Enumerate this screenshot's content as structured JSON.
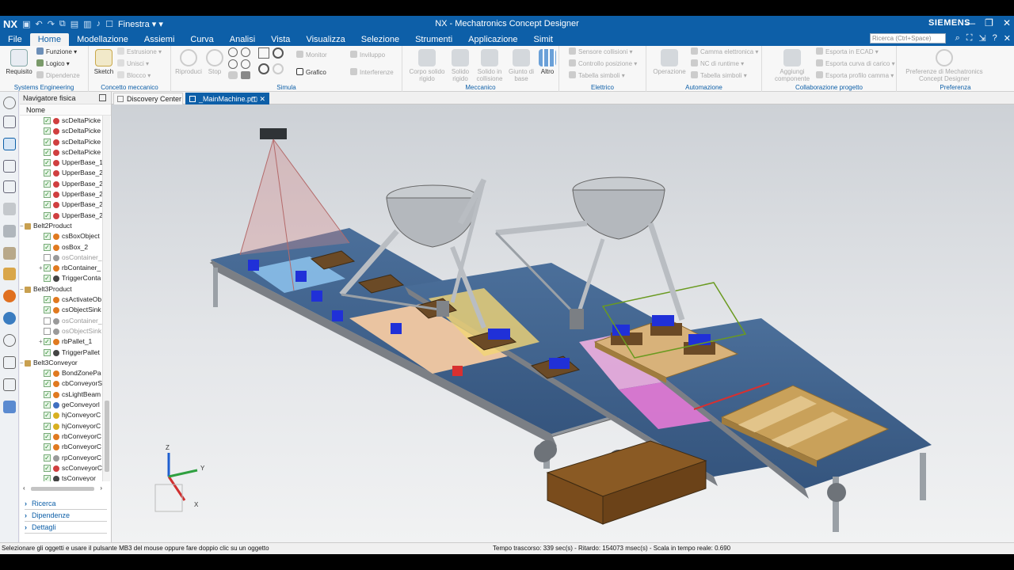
{
  "titlebar": {
    "logo": "NX",
    "window_menu": "Finestra",
    "title": "NX - Mechatronics Concept Designer",
    "brand": "SIEMENS"
  },
  "menubar": {
    "items": [
      "File",
      "Home",
      "Modellazione",
      "Assiemi",
      "Curva",
      "Analisi",
      "Vista",
      "Visualizza",
      "Selezione",
      "Strumenti",
      "Applicazione",
      "Simit"
    ],
    "search_placeholder": "Ricerca (Ctrl+Space)"
  },
  "ribbon": {
    "groups": [
      "Systems Engineering",
      "Concetto meccanico",
      "Simula",
      "Meccanico",
      "Elettrico",
      "Automazione",
      "Collaborazione progetto",
      "Preferenza"
    ],
    "requisito": "Requisito",
    "funzione": "Funzione",
    "logico": "Logico",
    "dipendenze": "Dipendenze",
    "sketch": "Sketch",
    "estrusione": "Estrusione",
    "unisci": "Unisci",
    "blocco": "Blocco",
    "riproduci": "Riproduci",
    "stop": "Stop",
    "monitor": "Monitor",
    "inviluppo": "Inviluppo",
    "grafico": "Grafico",
    "interferenze": "Interferenze",
    "corpo_rigido": "Corpo solido rigido",
    "solido_rigido": "Solido rigido",
    "solido_collisione": "Solido in collisione",
    "giunto_base": "Giunto di base",
    "altro": "Altro",
    "sensore_collisioni": "Sensore collisioni",
    "controllo_posizione": "Controllo posizione",
    "tabella_simboli": "Tabella simboli",
    "operazione": "Operazione",
    "camma_elettronica": "Camma elettronica",
    "nc_runtime": "NC di runtime",
    "tabella_simboli_2": "Tabella simboli",
    "aggiungi_componente": "Aggiungi componente",
    "esporta_ecad": "Esporta in ECAD",
    "esporta_curva": "Esporta curva di carico",
    "esporta_profilo": "Esporta profilo camma",
    "preferenze_mcd": "Preferenze di Mechatronics Concept Designer"
  },
  "navigator": {
    "title": "Navigatore fisica",
    "column": "Nome",
    "rows": [
      {
        "label": "scDeltaPicke",
        "indent": 3,
        "checked": true,
        "icon": "red"
      },
      {
        "label": "scDeltaPicke",
        "indent": 3,
        "checked": true,
        "icon": "red"
      },
      {
        "label": "scDeltaPicke",
        "indent": 3,
        "checked": true,
        "icon": "red"
      },
      {
        "label": "scDeltaPicke",
        "indent": 3,
        "checked": true,
        "icon": "red"
      },
      {
        "label": "UpperBase_1",
        "indent": 3,
        "checked": true,
        "icon": "red"
      },
      {
        "label": "UpperBase_2",
        "indent": 3,
        "checked": true,
        "icon": "red"
      },
      {
        "label": "UpperBase_2",
        "indent": 3,
        "checked": true,
        "icon": "red"
      },
      {
        "label": "UpperBase_2",
        "indent": 3,
        "checked": true,
        "icon": "red"
      },
      {
        "label": "UpperBase_2",
        "indent": 3,
        "checked": true,
        "icon": "red"
      },
      {
        "label": "UpperBase_2",
        "indent": 3,
        "checked": true,
        "icon": "red"
      },
      {
        "label": "Belt2Product",
        "indent": 1,
        "checked": null,
        "icon": "folder",
        "expander": "−"
      },
      {
        "label": "csBoxObject",
        "indent": 3,
        "checked": true,
        "icon": "orange"
      },
      {
        "label": "osBox_2",
        "indent": 3,
        "checked": true,
        "icon": "orange"
      },
      {
        "label": "osContainer_",
        "indent": 3,
        "checked": false,
        "icon": "grey",
        "dim": true
      },
      {
        "label": "rbContainer_",
        "indent": 3,
        "checked": true,
        "icon": "orange",
        "expander": "+"
      },
      {
        "label": "TriggerConta",
        "indent": 3,
        "checked": true,
        "icon": "dark"
      },
      {
        "label": "Belt3Product",
        "indent": 1,
        "checked": null,
        "icon": "folder",
        "expander": "−"
      },
      {
        "label": "csActivateOb",
        "indent": 3,
        "checked": true,
        "icon": "orange"
      },
      {
        "label": "csObjectSink",
        "indent": 3,
        "checked": true,
        "icon": "orange"
      },
      {
        "label": "osContainer_",
        "indent": 3,
        "checked": false,
        "icon": "grey",
        "dim": true
      },
      {
        "label": "osObjectSink",
        "indent": 3,
        "checked": false,
        "icon": "grey",
        "dim": true
      },
      {
        "label": "rbPallet_1",
        "indent": 3,
        "checked": true,
        "icon": "orange",
        "expander": "+"
      },
      {
        "label": "TriggerPallet",
        "indent": 3,
        "checked": true,
        "icon": "dark"
      },
      {
        "label": "Belt3Conveyor",
        "indent": 1,
        "checked": null,
        "icon": "folder",
        "expander": "−"
      },
      {
        "label": "BondZonePa",
        "indent": 3,
        "checked": true,
        "icon": "orange"
      },
      {
        "label": "cbConveyorS",
        "indent": 3,
        "checked": true,
        "icon": "orange"
      },
      {
        "label": "csLightBeam",
        "indent": 3,
        "checked": true,
        "icon": "orange"
      },
      {
        "label": "geConveyorl",
        "indent": 3,
        "checked": true,
        "icon": "blue"
      },
      {
        "label": "hjConveyorC",
        "indent": 3,
        "checked": true,
        "icon": "yellow"
      },
      {
        "label": "hjConveyorC",
        "indent": 3,
        "checked": true,
        "icon": "yellow"
      },
      {
        "label": "rbConveyorC",
        "indent": 3,
        "checked": true,
        "icon": "orange"
      },
      {
        "label": "rbConveyorC",
        "indent": 3,
        "checked": true,
        "icon": "orange"
      },
      {
        "label": "rpConveyorC",
        "indent": 3,
        "checked": true,
        "icon": "grey"
      },
      {
        "label": "scConveyorC",
        "indent": 3,
        "checked": true,
        "icon": "red"
      },
      {
        "label": "tsConveyor_",
        "indent": 3,
        "checked": true,
        "icon": "dark"
      }
    ],
    "sections": [
      "Ricerca",
      "Dipendenze",
      "Dettagli"
    ]
  },
  "tabs": [
    {
      "label": "Discovery Center",
      "active": false
    },
    {
      "label": "_MainMachine.prt",
      "active": true
    }
  ],
  "status": {
    "left": "Selezionare gli oggetti e usare il pulsante MB3 del mouse oppure fare doppio clic su un oggetto",
    "right": "Tempo trascorso: 339 sec(s) - Ritardo: 154073 msec(s) - Scala in tempo reale: 0.690"
  },
  "axes": {
    "x": "X",
    "y": "Y",
    "z": "Z"
  },
  "colors": {
    "accent": "#0d5fa8",
    "conveyor": "#3e5f86",
    "box": "#1f2fd0",
    "wood": "#c9a15a"
  }
}
